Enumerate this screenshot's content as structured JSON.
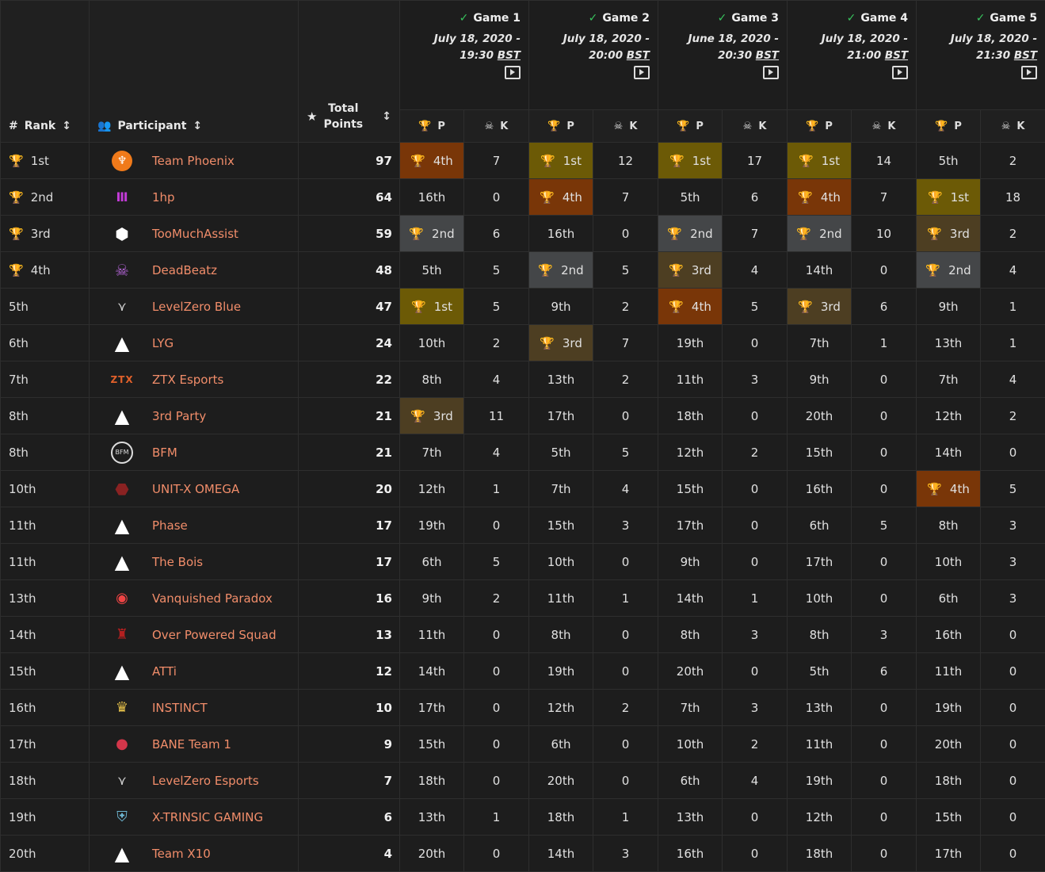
{
  "colors": {
    "gold": "#6c5a06",
    "silver": "#444648",
    "bronze": "#4d3e22",
    "orange": "#793608",
    "name": "#f18d6a"
  },
  "header": {
    "rank": "Rank",
    "participant": "Participant",
    "total_points_line1": "Total",
    "total_points_line2": "Points",
    "p": "P",
    "k": "K"
  },
  "games": [
    {
      "name": "Game 1",
      "date1": "July 18, 2020 -",
      "time": "19:30",
      "tz": "BST"
    },
    {
      "name": "Game 2",
      "date1": "July 18, 2020 -",
      "time": "20:00",
      "tz": "BST"
    },
    {
      "name": "Game 3",
      "date1": "June 18, 2020 -",
      "time": "20:30",
      "tz": "BST"
    },
    {
      "name": "Game 4",
      "date1": "July 18, 2020 -",
      "time": "21:00",
      "tz": "BST"
    },
    {
      "name": "Game 5",
      "date1": "July 18, 2020 -",
      "time": "21:30",
      "tz": "BST"
    }
  ],
  "rows": [
    {
      "rank": "1st",
      "rank_trophy": "gold",
      "name": "Team Phoenix",
      "logo": "phoenix-logo",
      "points": "97",
      "games": [
        [
          "4th",
          7,
          "orange"
        ],
        [
          "1st",
          12,
          "gold"
        ],
        [
          "1st",
          17,
          "gold"
        ],
        [
          "1st",
          14,
          "gold"
        ],
        [
          "5th",
          2,
          ""
        ]
      ]
    },
    {
      "rank": "2nd",
      "rank_trophy": "silver",
      "name": "1hp",
      "logo": "1hp-logo",
      "points": "64",
      "games": [
        [
          "16th",
          0,
          ""
        ],
        [
          "4th",
          7,
          "orange"
        ],
        [
          "5th",
          6,
          ""
        ],
        [
          "4th",
          7,
          "orange"
        ],
        [
          "1st",
          18,
          "gold"
        ]
      ]
    },
    {
      "rank": "3rd",
      "rank_trophy": "bronze",
      "name": "TooMuchAssist",
      "logo": "tma-logo",
      "points": "59",
      "games": [
        [
          "2nd",
          6,
          "silver"
        ],
        [
          "16th",
          0,
          ""
        ],
        [
          "2nd",
          7,
          "silver"
        ],
        [
          "2nd",
          10,
          "silver"
        ],
        [
          "3rd",
          2,
          "bronze"
        ]
      ]
    },
    {
      "rank": "4th",
      "rank_trophy": "orange",
      "name": "DeadBeatz",
      "logo": "skull-logo",
      "points": "48",
      "games": [
        [
          "5th",
          5,
          ""
        ],
        [
          "2nd",
          5,
          "silver"
        ],
        [
          "3rd",
          4,
          "bronze"
        ],
        [
          "14th",
          0,
          ""
        ],
        [
          "2nd",
          4,
          "silver"
        ]
      ]
    },
    {
      "rank": "5th",
      "rank_trophy": "",
      "name": "LevelZero Blue",
      "logo": "levelzero-logo",
      "points": "47",
      "games": [
        [
          "1st",
          5,
          "gold"
        ],
        [
          "9th",
          2,
          ""
        ],
        [
          "4th",
          5,
          "orange"
        ],
        [
          "3rd",
          6,
          "bronze"
        ],
        [
          "9th",
          1,
          ""
        ]
      ]
    },
    {
      "rank": "6th",
      "rank_trophy": "",
      "name": "LYG",
      "logo": "apex-logo",
      "points": "24",
      "games": [
        [
          "10th",
          2,
          ""
        ],
        [
          "3rd",
          7,
          "bronze"
        ],
        [
          "19th",
          0,
          ""
        ],
        [
          "7th",
          1,
          ""
        ],
        [
          "13th",
          1,
          ""
        ]
      ]
    },
    {
      "rank": "7th",
      "rank_trophy": "",
      "name": "ZTX Esports",
      "logo": "ztx-logo",
      "points": "22",
      "games": [
        [
          "8th",
          4,
          ""
        ],
        [
          "13th",
          2,
          ""
        ],
        [
          "11th",
          3,
          ""
        ],
        [
          "9th",
          0,
          ""
        ],
        [
          "7th",
          4,
          ""
        ]
      ]
    },
    {
      "rank": "8th",
      "rank_trophy": "",
      "name": "3rd Party",
      "logo": "apex-logo",
      "points": "21",
      "games": [
        [
          "3rd",
          11,
          "bronze"
        ],
        [
          "17th",
          0,
          ""
        ],
        [
          "18th",
          0,
          ""
        ],
        [
          "20th",
          0,
          ""
        ],
        [
          "12th",
          2,
          ""
        ]
      ]
    },
    {
      "rank": "8th",
      "rank_trophy": "",
      "name": "BFM",
      "logo": "bfm-logo",
      "points": "21",
      "games": [
        [
          "7th",
          4,
          ""
        ],
        [
          "5th",
          5,
          ""
        ],
        [
          "12th",
          2,
          ""
        ],
        [
          "15th",
          0,
          ""
        ],
        [
          "14th",
          0,
          ""
        ]
      ]
    },
    {
      "rank": "10th",
      "rank_trophy": "",
      "name": "UNIT-X OMEGA",
      "logo": "unitx-logo",
      "points": "20",
      "games": [
        [
          "12th",
          1,
          ""
        ],
        [
          "7th",
          4,
          ""
        ],
        [
          "15th",
          0,
          ""
        ],
        [
          "16th",
          0,
          ""
        ],
        [
          "4th",
          5,
          "orange"
        ]
      ]
    },
    {
      "rank": "11th",
      "rank_trophy": "",
      "name": "Phase",
      "logo": "apex-logo",
      "points": "17",
      "games": [
        [
          "19th",
          0,
          ""
        ],
        [
          "15th",
          3,
          ""
        ],
        [
          "17th",
          0,
          ""
        ],
        [
          "6th",
          5,
          ""
        ],
        [
          "8th",
          3,
          ""
        ]
      ]
    },
    {
      "rank": "11th",
      "rank_trophy": "",
      "name": "The Bois",
      "logo": "apex-logo",
      "points": "17",
      "games": [
        [
          "6th",
          5,
          ""
        ],
        [
          "10th",
          0,
          ""
        ],
        [
          "9th",
          0,
          ""
        ],
        [
          "17th",
          0,
          ""
        ],
        [
          "10th",
          3,
          ""
        ]
      ]
    },
    {
      "rank": "13th",
      "rank_trophy": "",
      "name": "Vanquished Paradox",
      "logo": "eagle-logo",
      "points": "16",
      "games": [
        [
          "9th",
          2,
          ""
        ],
        [
          "11th",
          1,
          ""
        ],
        [
          "14th",
          1,
          ""
        ],
        [
          "10th",
          0,
          ""
        ],
        [
          "6th",
          3,
          ""
        ]
      ]
    },
    {
      "rank": "14th",
      "rank_trophy": "",
      "name": "Over Powered Squad",
      "logo": "ops-logo",
      "points": "13",
      "games": [
        [
          "11th",
          0,
          ""
        ],
        [
          "8th",
          0,
          ""
        ],
        [
          "8th",
          3,
          ""
        ],
        [
          "8th",
          3,
          ""
        ],
        [
          "16th",
          0,
          ""
        ]
      ]
    },
    {
      "rank": "15th",
      "rank_trophy": "",
      "name": "ATTi",
      "logo": "apex-logo",
      "points": "12",
      "games": [
        [
          "14th",
          0,
          ""
        ],
        [
          "19th",
          0,
          ""
        ],
        [
          "20th",
          0,
          ""
        ],
        [
          "5th",
          6,
          ""
        ],
        [
          "11th",
          0,
          ""
        ]
      ]
    },
    {
      "rank": "16th",
      "rank_trophy": "",
      "name": "INSTINCT",
      "logo": "instinct-logo",
      "points": "10",
      "games": [
        [
          "17th",
          0,
          ""
        ],
        [
          "12th",
          2,
          ""
        ],
        [
          "7th",
          3,
          ""
        ],
        [
          "13th",
          0,
          ""
        ],
        [
          "19th",
          0,
          ""
        ]
      ]
    },
    {
      "rank": "17th",
      "rank_trophy": "",
      "name": "BANE Team 1",
      "logo": "bane-logo",
      "points": "9",
      "games": [
        [
          "15th",
          0,
          ""
        ],
        [
          "6th",
          0,
          ""
        ],
        [
          "10th",
          2,
          ""
        ],
        [
          "11th",
          0,
          ""
        ],
        [
          "20th",
          0,
          ""
        ]
      ]
    },
    {
      "rank": "18th",
      "rank_trophy": "",
      "name": "LevelZero Esports",
      "logo": "levelzero-logo",
      "points": "7",
      "games": [
        [
          "18th",
          0,
          ""
        ],
        [
          "20th",
          0,
          ""
        ],
        [
          "6th",
          4,
          ""
        ],
        [
          "19th",
          0,
          ""
        ],
        [
          "18th",
          0,
          ""
        ]
      ]
    },
    {
      "rank": "19th",
      "rank_trophy": "",
      "name": "X-TRINSIC GAMING",
      "logo": "xtrinsic-logo",
      "points": "6",
      "games": [
        [
          "13th",
          1,
          ""
        ],
        [
          "18th",
          1,
          ""
        ],
        [
          "13th",
          0,
          ""
        ],
        [
          "12th",
          0,
          ""
        ],
        [
          "15th",
          0,
          ""
        ]
      ]
    },
    {
      "rank": "20th",
      "rank_trophy": "",
      "name": "Team X10",
      "logo": "apex-logo",
      "points": "4",
      "games": [
        [
          "20th",
          0,
          ""
        ],
        [
          "14th",
          3,
          ""
        ],
        [
          "16th",
          0,
          ""
        ],
        [
          "18th",
          0,
          ""
        ],
        [
          "17th",
          0,
          ""
        ]
      ]
    }
  ]
}
